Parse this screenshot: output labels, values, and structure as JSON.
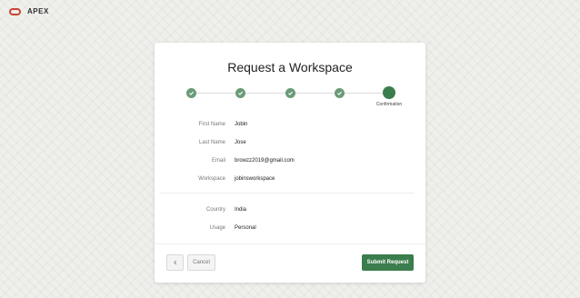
{
  "header": {
    "brand": "APEX",
    "logo_icon": "oracle-logo-icon"
  },
  "card": {
    "title": "Request a Workspace"
  },
  "progress": {
    "total_steps": 5,
    "completed_steps": 4,
    "current_step_label": "Confirmation",
    "check_icon": "checkmark-icon"
  },
  "fields": {
    "first_name": {
      "label": "First Name",
      "value": "Jobin"
    },
    "last_name": {
      "label": "Last Name",
      "value": "Jose"
    },
    "email": {
      "label": "Email",
      "value": "browzz2019@gmail.com"
    },
    "workspace": {
      "label": "Workspace",
      "value": "jobinsworkspace"
    },
    "country": {
      "label": "Country",
      "value": "India"
    },
    "usage": {
      "label": "Usage",
      "value": "Personal"
    }
  },
  "buttons": {
    "back_icon": "chevron-left-icon",
    "cancel_label": "Cancel",
    "submit_label": "Submit Request"
  },
  "colors": {
    "accent": "#3b7d4d",
    "accent_light": "#6b9b76",
    "logo": "#c74634"
  }
}
